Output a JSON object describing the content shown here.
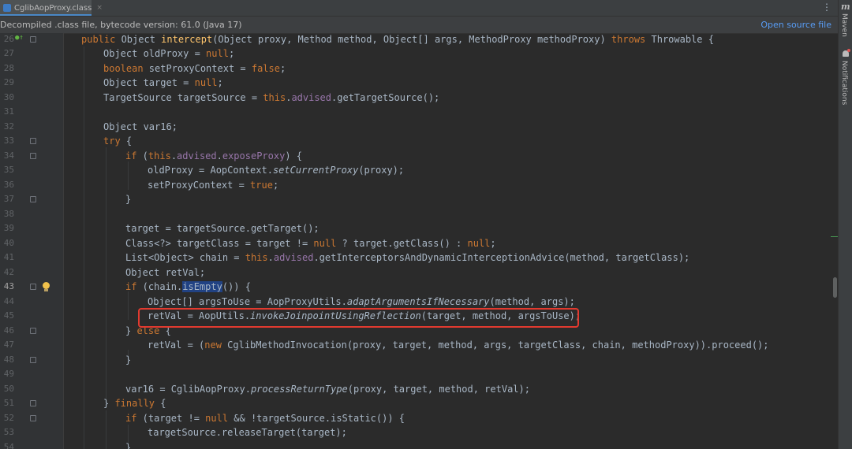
{
  "tab": {
    "title": "CglibAopProxy.class",
    "close_glyph": "×",
    "file_icon": "class-file-icon"
  },
  "toolbar": {
    "more_glyph": "⋮"
  },
  "banner": {
    "text": "Decompiled .class file, bytecode version: 61.0 (Java 17)",
    "open_source_link": "Open source file"
  },
  "rightbar": {
    "maven_icon": "m",
    "maven_label": "Maven",
    "notifications_label": "Notifications"
  },
  "editor": {
    "lines": [
      {
        "number": "26",
        "text": "public Object intercept(Object proxy, Method method, Object[] args, MethodProxy methodProxy) throws Throwable {"
      },
      {
        "number": "27",
        "text": "Object oldProxy = null;"
      },
      {
        "number": "28",
        "text": "boolean setProxyContext = false;"
      },
      {
        "number": "29",
        "text": "Object target = null;"
      },
      {
        "number": "30",
        "text": "TargetSource targetSource = this.advised.getTargetSource();"
      },
      {
        "number": "31",
        "text": ""
      },
      {
        "number": "32",
        "text": "Object var16;"
      },
      {
        "number": "33",
        "text": "try {"
      },
      {
        "number": "34",
        "text": "if (this.advised.exposeProxy) {"
      },
      {
        "number": "35",
        "text": "oldProxy = AopContext.setCurrentProxy(proxy);"
      },
      {
        "number": "36",
        "text": "setProxyContext = true;"
      },
      {
        "number": "37",
        "text": "}"
      },
      {
        "number": "38",
        "text": ""
      },
      {
        "number": "39",
        "text": "target = targetSource.getTarget();"
      },
      {
        "number": "40",
        "text": "Class<?> targetClass = target != null ? target.getClass() : null;"
      },
      {
        "number": "41",
        "text": "List<Object> chain = this.advised.getInterceptorsAndDynamicInterceptionAdvice(method, targetClass);"
      },
      {
        "number": "42",
        "text": "Object retVal;"
      },
      {
        "number": "43",
        "text": "if (chain.isEmpty()) {"
      },
      {
        "number": "44",
        "text": "Object[] argsToUse = AopProxyUtils.adaptArgumentsIfNecessary(method, args);"
      },
      {
        "number": "45",
        "text": "retVal = AopUtils.invokeJoinpointUsingReflection(target, method, argsToUse);"
      },
      {
        "number": "46",
        "text": "} else {"
      },
      {
        "number": "47",
        "text": "retVal = (new CglibMethodInvocation(proxy, target, method, args, targetClass, chain, methodProxy)).proceed();"
      },
      {
        "number": "48",
        "text": "}"
      },
      {
        "number": "49",
        "text": ""
      },
      {
        "number": "50",
        "text": "var16 = CglibAopProxy.processReturnType(proxy, target, method, retVal);"
      },
      {
        "number": "51",
        "text": "} finally {"
      },
      {
        "number": "52",
        "text": "if (target != null && !targetSource.isStatic()) {"
      },
      {
        "number": "53",
        "text": "targetSource.releaseTarget(target);"
      },
      {
        "number": "54",
        "text": "}"
      }
    ],
    "highlighted_line": "45",
    "current_line": "43",
    "gutter_icons": {
      "overriding": "override-icon",
      "intention": "lightbulb-icon"
    }
  }
}
